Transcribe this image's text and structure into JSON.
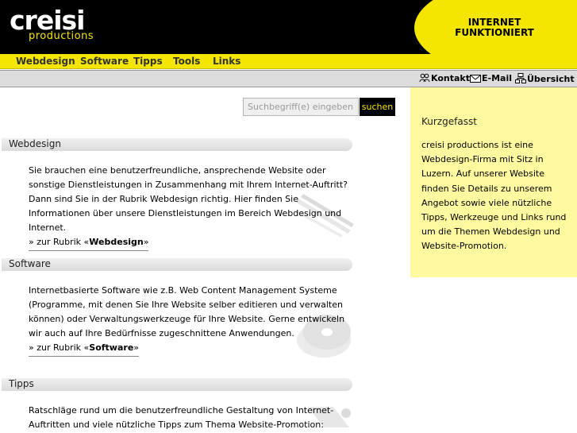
{
  "header": {
    "logo_main": "creisi",
    "logo_sub": "productions",
    "slogan_line1": "INTERNET",
    "slogan_line2": "FUNKTIONIERT"
  },
  "nav": {
    "items": [
      "Webdesign",
      "Software",
      "Tipps",
      "Tools",
      "Links"
    ]
  },
  "utility": {
    "contact": "Kontakt",
    "email": "E-Mail",
    "overview": "Übersicht"
  },
  "search": {
    "placeholder": "Suchbegriff(e) eingeben",
    "button": "suchen"
  },
  "sections": [
    {
      "title": "Webdesign",
      "text": "Sie brauchen eine benutzerfreundliche, ansprechende Website oder sonstige Dienstleistungen in Zusammenhang mit Ihrem Internet-Auftritt? Dann sind Sie in der Rubrik Webdesign richtig. Hier finden Sie Informationen über unsere Dienstleistungen im Bereich Webdesign und Internet.",
      "more_prefix": "» zur Rubrik «",
      "more_label": "Webdesign",
      "more_suffix": "»"
    },
    {
      "title": "Software",
      "text": "Internetbasierte Software wie z.B. Web Content Management Systeme (Programme, mit denen Sie Ihre Website selber editieren und verwalten können) oder Verwaltungswerkzeuge für Ihre Website. Gerne entwickeln wir auch auf Ihre Bedürfnisse zugeschnittene Anwendungen.",
      "more_prefix": "» zur Rubrik «",
      "more_label": "Software",
      "more_suffix": "»"
    },
    {
      "title": "Tipps",
      "text": "Ratschläge rund um die benutzerfreundliche Gestaltung von Internet-Auftritten und viele nützliche Tipps zum Thema Website-Promotion: Unsere"
    }
  ],
  "sidebar": {
    "title": "Kurzgefasst",
    "text": "creisi productions ist eine Webdesign-Firma mit Sitz in Luzern. Auf unserer Website finden Sie Details zu unserem Angebot sowie viele nützliche Tipps, Werkzeuge und Links rund um die Themen Webdesign und Website-Promotion."
  },
  "colors": {
    "brand_yellow": "#f5e600",
    "header_black": "#000000",
    "sidebar_bg": "#fffa9f",
    "section_bar": "#e4e4e4"
  },
  "icons": [
    "contact-people-icon",
    "envelope-icon",
    "sitemap-icon"
  ]
}
